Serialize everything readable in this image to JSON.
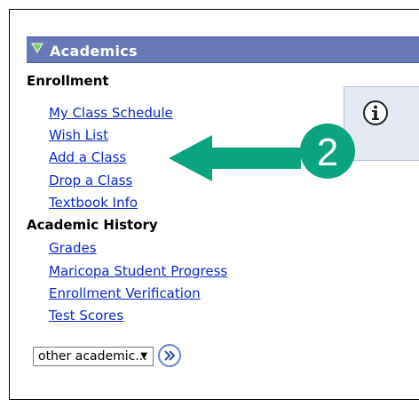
{
  "section": {
    "title": "Academics"
  },
  "enrollment": {
    "heading": "Enrollment",
    "links": [
      "My Class Schedule",
      "Wish List",
      "Add a Class",
      "Drop a Class",
      "Textbook Info"
    ]
  },
  "academic_history": {
    "heading": "Academic History",
    "links": [
      "Grades",
      "Maricopa Student Progress",
      "Enrollment Verification",
      "Test Scores"
    ]
  },
  "callout": {
    "number": "2"
  },
  "dropdown": {
    "selected": "other academic..."
  },
  "colors": {
    "header_bg": "#6879b8",
    "link": "#0b28c8",
    "callout_green": "#0aa57f"
  }
}
